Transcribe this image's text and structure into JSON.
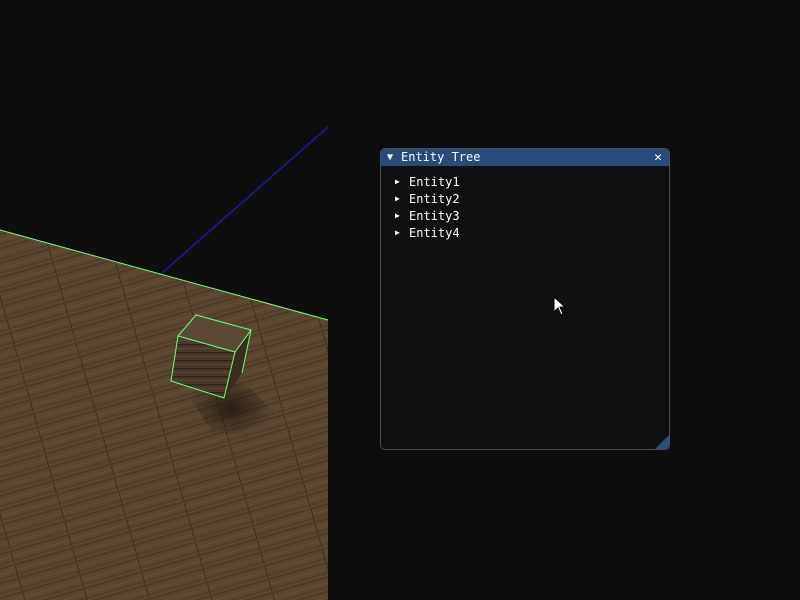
{
  "window": {
    "title": "Entity Tree",
    "collapse_icon": "triangle-down",
    "close_icon": "close-x",
    "resize_icon": "resize-grip"
  },
  "tree": {
    "items": [
      {
        "label": "Entity1",
        "expanded": false
      },
      {
        "label": "Entity2",
        "expanded": false
      },
      {
        "label": "Entity3",
        "expanded": false
      },
      {
        "label": "Entity4",
        "expanded": false
      }
    ]
  },
  "colors": {
    "title_bar": "#2a4a7c",
    "window_bg": "#0f1011",
    "floor": "#5a4530",
    "selection_outline": "#6dff7a",
    "axis_line": "#1a1aa0"
  }
}
